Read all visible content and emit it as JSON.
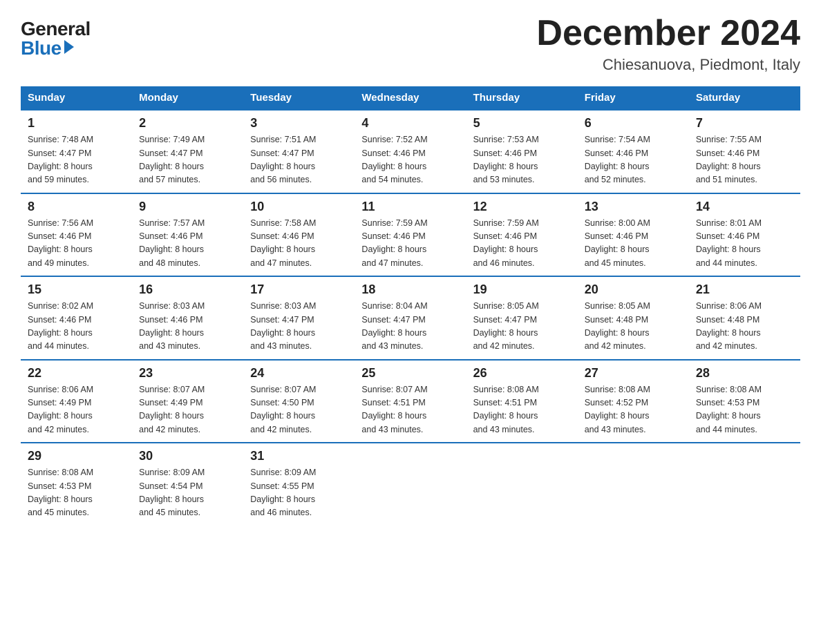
{
  "logo": {
    "general": "General",
    "blue": "Blue"
  },
  "title": {
    "month": "December 2024",
    "location": "Chiesanuova, Piedmont, Italy"
  },
  "weekdays": [
    "Sunday",
    "Monday",
    "Tuesday",
    "Wednesday",
    "Thursday",
    "Friday",
    "Saturday"
  ],
  "weeks": [
    [
      {
        "day": "1",
        "sunrise": "7:48 AM",
        "sunset": "4:47 PM",
        "daylight": "8 hours and 59 minutes."
      },
      {
        "day": "2",
        "sunrise": "7:49 AM",
        "sunset": "4:47 PM",
        "daylight": "8 hours and 57 minutes."
      },
      {
        "day": "3",
        "sunrise": "7:51 AM",
        "sunset": "4:47 PM",
        "daylight": "8 hours and 56 minutes."
      },
      {
        "day": "4",
        "sunrise": "7:52 AM",
        "sunset": "4:46 PM",
        "daylight": "8 hours and 54 minutes."
      },
      {
        "day": "5",
        "sunrise": "7:53 AM",
        "sunset": "4:46 PM",
        "daylight": "8 hours and 53 minutes."
      },
      {
        "day": "6",
        "sunrise": "7:54 AM",
        "sunset": "4:46 PM",
        "daylight": "8 hours and 52 minutes."
      },
      {
        "day": "7",
        "sunrise": "7:55 AM",
        "sunset": "4:46 PM",
        "daylight": "8 hours and 51 minutes."
      }
    ],
    [
      {
        "day": "8",
        "sunrise": "7:56 AM",
        "sunset": "4:46 PM",
        "daylight": "8 hours and 49 minutes."
      },
      {
        "day": "9",
        "sunrise": "7:57 AM",
        "sunset": "4:46 PM",
        "daylight": "8 hours and 48 minutes."
      },
      {
        "day": "10",
        "sunrise": "7:58 AM",
        "sunset": "4:46 PM",
        "daylight": "8 hours and 47 minutes."
      },
      {
        "day": "11",
        "sunrise": "7:59 AM",
        "sunset": "4:46 PM",
        "daylight": "8 hours and 47 minutes."
      },
      {
        "day": "12",
        "sunrise": "7:59 AM",
        "sunset": "4:46 PM",
        "daylight": "8 hours and 46 minutes."
      },
      {
        "day": "13",
        "sunrise": "8:00 AM",
        "sunset": "4:46 PM",
        "daylight": "8 hours and 45 minutes."
      },
      {
        "day": "14",
        "sunrise": "8:01 AM",
        "sunset": "4:46 PM",
        "daylight": "8 hours and 44 minutes."
      }
    ],
    [
      {
        "day": "15",
        "sunrise": "8:02 AM",
        "sunset": "4:46 PM",
        "daylight": "8 hours and 44 minutes."
      },
      {
        "day": "16",
        "sunrise": "8:03 AM",
        "sunset": "4:46 PM",
        "daylight": "8 hours and 43 minutes."
      },
      {
        "day": "17",
        "sunrise": "8:03 AM",
        "sunset": "4:47 PM",
        "daylight": "8 hours and 43 minutes."
      },
      {
        "day": "18",
        "sunrise": "8:04 AM",
        "sunset": "4:47 PM",
        "daylight": "8 hours and 43 minutes."
      },
      {
        "day": "19",
        "sunrise": "8:05 AM",
        "sunset": "4:47 PM",
        "daylight": "8 hours and 42 minutes."
      },
      {
        "day": "20",
        "sunrise": "8:05 AM",
        "sunset": "4:48 PM",
        "daylight": "8 hours and 42 minutes."
      },
      {
        "day": "21",
        "sunrise": "8:06 AM",
        "sunset": "4:48 PM",
        "daylight": "8 hours and 42 minutes."
      }
    ],
    [
      {
        "day": "22",
        "sunrise": "8:06 AM",
        "sunset": "4:49 PM",
        "daylight": "8 hours and 42 minutes."
      },
      {
        "day": "23",
        "sunrise": "8:07 AM",
        "sunset": "4:49 PM",
        "daylight": "8 hours and 42 minutes."
      },
      {
        "day": "24",
        "sunrise": "8:07 AM",
        "sunset": "4:50 PM",
        "daylight": "8 hours and 42 minutes."
      },
      {
        "day": "25",
        "sunrise": "8:07 AM",
        "sunset": "4:51 PM",
        "daylight": "8 hours and 43 minutes."
      },
      {
        "day": "26",
        "sunrise": "8:08 AM",
        "sunset": "4:51 PM",
        "daylight": "8 hours and 43 minutes."
      },
      {
        "day": "27",
        "sunrise": "8:08 AM",
        "sunset": "4:52 PM",
        "daylight": "8 hours and 43 minutes."
      },
      {
        "day": "28",
        "sunrise": "8:08 AM",
        "sunset": "4:53 PM",
        "daylight": "8 hours and 44 minutes."
      }
    ],
    [
      {
        "day": "29",
        "sunrise": "8:08 AM",
        "sunset": "4:53 PM",
        "daylight": "8 hours and 45 minutes."
      },
      {
        "day": "30",
        "sunrise": "8:09 AM",
        "sunset": "4:54 PM",
        "daylight": "8 hours and 45 minutes."
      },
      {
        "day": "31",
        "sunrise": "8:09 AM",
        "sunset": "4:55 PM",
        "daylight": "8 hours and 46 minutes."
      },
      null,
      null,
      null,
      null
    ]
  ],
  "labels": {
    "sunrise": "Sunrise:",
    "sunset": "Sunset:",
    "daylight": "Daylight:"
  }
}
